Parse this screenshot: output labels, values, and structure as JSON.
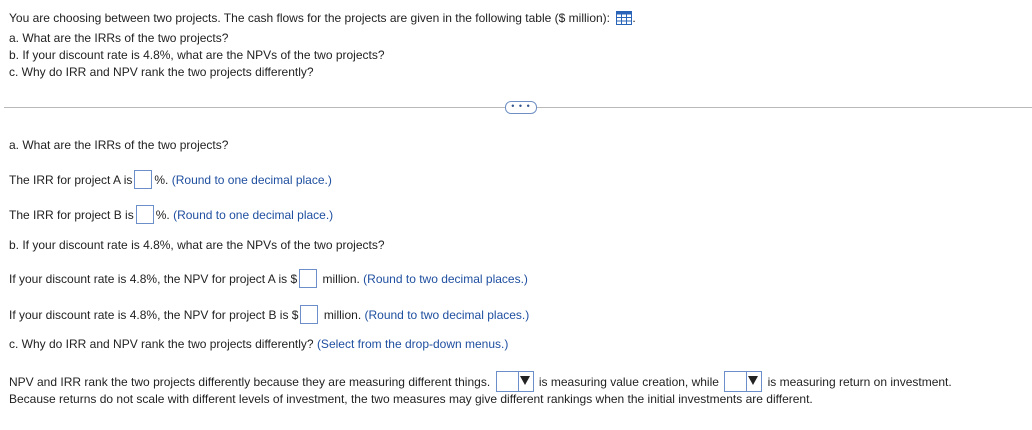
{
  "question": {
    "intro": "You are choosing between two projects. The cash flows for the projects are given in the following table ($ million):",
    "intro_end": ".",
    "table_icon": "table-grid-icon",
    "parts": [
      "a. What are the IRRs of the two projects?",
      "b. If your discount rate is 4.8%, what are the NPVs of the two projects?",
      "c. Why do IRR and NPV rank the two projects differently?"
    ]
  },
  "more_button": "• • •",
  "answers": {
    "part_a_heading": "a. What are the IRRs of the two projects?",
    "irr_a": {
      "prefix": "The IRR for project A is",
      "suffix": "%.",
      "hint": "(Round to one decimal place.)",
      "value": ""
    },
    "irr_b": {
      "prefix": "The IRR for project B is",
      "suffix": "%.",
      "hint": "(Round to one decimal place.)",
      "value": ""
    },
    "part_b_heading": "b. If your discount rate is 4.8%, what are the NPVs of the two projects?",
    "npv_a": {
      "prefix": "If your discount rate is 4.8%, the NPV for project A is $",
      "suffix": "million.",
      "hint": "(Round to two decimal places.)",
      "value": ""
    },
    "npv_b": {
      "prefix": "If your discount rate is 4.8%, the NPV for project B is $",
      "suffix": "million.",
      "hint": "(Round to two decimal places.)",
      "value": ""
    },
    "part_c_heading": "c. Why do IRR and NPV rank the two projects differently?",
    "part_c_hint": "(Select from the drop-down menus.)",
    "sentence_1_start": "NPV and IRR rank the two projects differently because they are measuring different things.",
    "sentence_1_mid": "is measuring value creation, while",
    "sentence_1_end": "is measuring return on investment.",
    "sentence_2": "Because returns do not scale with different levels of investment, the two measures may give different rankings when the initial investments are different.",
    "dropdown_1_selected": "",
    "dropdown_2_selected": ""
  },
  "colors": {
    "accent": "#1f4fa0",
    "input_border": "#6c8ec9",
    "divider": "#b9b9b9"
  }
}
